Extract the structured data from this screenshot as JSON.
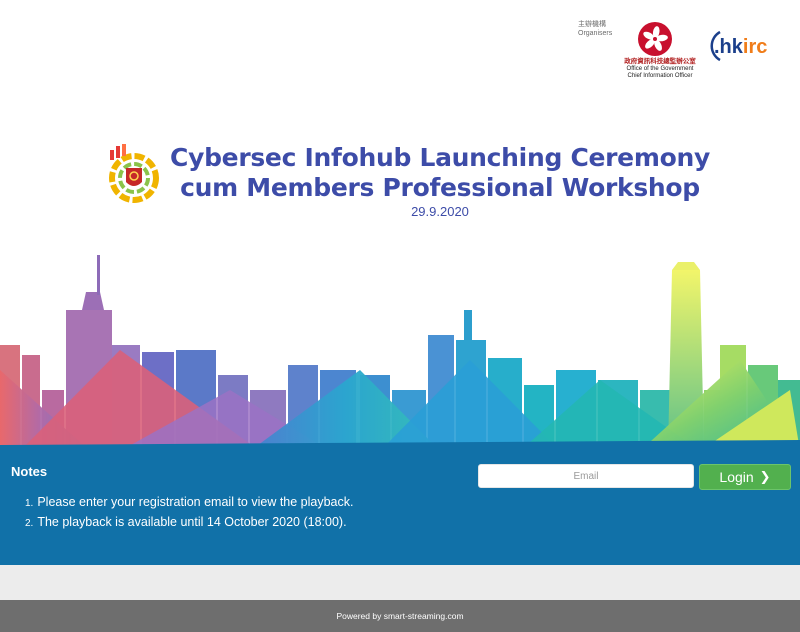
{
  "organisers": {
    "label_zh": "主辦機構",
    "label_en": "Organisers",
    "ogcio_name_zh": "政府資訊科技總監辦公室",
    "ogcio_name_en_line1": "Office of the Government",
    "ogcio_name_en_line2": "Chief Information Officer",
    "hkirc_logo_text": ".hkirc"
  },
  "event": {
    "title_line1": "Cybersec Infohub Launching Ceremony",
    "title_line2": "cum Members Professional Workshop",
    "date": "29.9.2020"
  },
  "notes": {
    "title": "Notes",
    "items": [
      {
        "num": "1.",
        "text": "Please enter your registration email to view the playback."
      },
      {
        "num": "2.",
        "text": "The playback is available until 14 October 2020 (18:00)."
      }
    ]
  },
  "login": {
    "email_placeholder": "Email",
    "email_value": "",
    "button_label": "Login",
    "button_icon": "chevron-right-icon"
  },
  "footer": {
    "text": "Powered by smart-streaming.com"
  },
  "colors": {
    "title_blue": "#3d4ca8",
    "panel_blue": "#1171a8",
    "login_green": "#52b04e",
    "footer_grey": "#6e6e6e"
  }
}
